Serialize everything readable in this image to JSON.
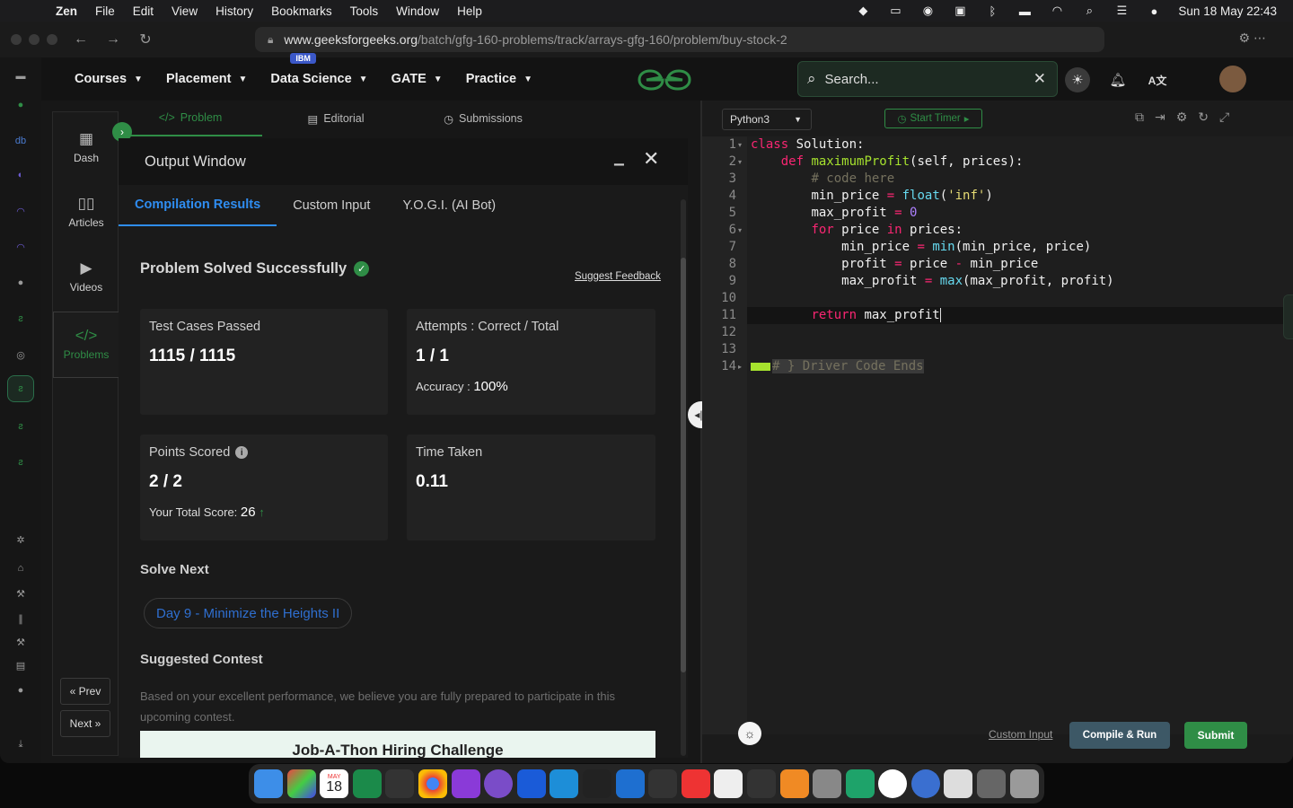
{
  "menubar": {
    "app_name": "Zen",
    "items": [
      "File",
      "Edit",
      "View",
      "History",
      "Bookmarks",
      "Tools",
      "Window",
      "Help"
    ],
    "datetime": "Sun 18 May  22:43"
  },
  "browser": {
    "url_host": "www.geeksforgeeks.org",
    "url_path": "/batch/gfg-160-problems/track/arrays-gfg-160/problem/buy-stock-2"
  },
  "topnav": {
    "items": [
      "Courses",
      "Placement",
      "Data Science",
      "GATE",
      "Practice"
    ],
    "badge": "IBM",
    "search_placeholder": "Search...",
    "logo_color": "#2f8d46"
  },
  "sidebar": {
    "items": [
      {
        "label": "Dash",
        "icon": "dashboard-icon"
      },
      {
        "label": "Articles",
        "icon": "book-icon"
      },
      {
        "label": "Videos",
        "icon": "video-icon"
      },
      {
        "label": "Problems",
        "icon": "code-icon"
      }
    ],
    "prev": "« Prev",
    "next": "Next »"
  },
  "problem_tabs": [
    "Problem",
    "Editorial",
    "Submissions"
  ],
  "output_window": {
    "title": "Output Window",
    "tabs": [
      "Compilation Results",
      "Custom Input",
      "Y.O.G.I. (AI Bot)"
    ],
    "status": "Problem Solved Successfully",
    "feedback": "Suggest Feedback",
    "cards": {
      "tests_label": "Test Cases Passed",
      "tests_value": "1115 / 1115",
      "attempts_label": "Attempts : Correct / Total",
      "attempts_value": "1 / 1",
      "accuracy_label": "Accuracy :",
      "accuracy_value": "100%",
      "points_label": "Points Scored",
      "points_value": "2 / 2",
      "total_score_label": "Your Total Score:",
      "total_score_value": "26",
      "time_label": "Time Taken",
      "time_value": "0.11"
    },
    "solve_next_heading": "Solve Next",
    "solve_next_item": "Day 9 - Minimize the Heights II",
    "contest_heading": "Suggested Contest",
    "contest_text": "Based on your excellent performance, we believe you are fully prepared to participate in this upcoming contest.",
    "contest_banner": "Job-A-Thon Hiring Challenge"
  },
  "editor": {
    "language": "Python3",
    "timer_label": "Start Timer",
    "line_numbers": [
      "1",
      "2",
      "3",
      "4",
      "5",
      "6",
      "7",
      "8",
      "9",
      "10",
      "11",
      "12",
      "13",
      "14"
    ],
    "code": {
      "l1_kw": "class",
      "l1_rest": " Solution:",
      "l2_kw": "def",
      "l2_fn": "maximumProfit",
      "l2_rest": "(self, prices):",
      "l3": "# code here",
      "l4_a": "min_price ",
      "l4_op": "=",
      "l4_fn": " float",
      "l4_b": "(",
      "l4_str": "'inf'",
      "l4_c": ")",
      "l5_a": "max_profit ",
      "l5_op": "=",
      "l5_num": " 0",
      "l6_kw": "for",
      "l6_a": " price ",
      "l6_in": "in",
      "l6_b": " prices:",
      "l7_a": "min_price ",
      "l7_op": "=",
      "l7_fn": " min",
      "l7_b": "(min_price, price)",
      "l8_a": "profit ",
      "l8_op": "=",
      "l8_b": " price ",
      "l8_op2": "-",
      "l8_c": " min_price",
      "l9_a": "max_profit ",
      "l9_op": "=",
      "l9_fn": " max",
      "l9_b": "(max_profit, profit)",
      "l11_kw": "return",
      "l11_rest": " max_profit",
      "l14": "# } Driver Code Ends"
    },
    "custom_input": "Custom Input",
    "compile_run": "Compile & Run",
    "submit": "Submit"
  },
  "dock": {
    "calendar_month": "MAY",
    "calendar_day": "18"
  }
}
